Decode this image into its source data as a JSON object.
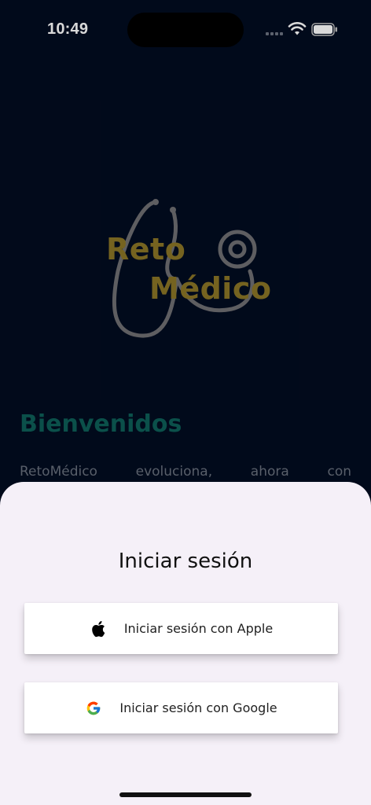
{
  "status_bar": {
    "time": "10:49"
  },
  "logo": {
    "line1": "Reto",
    "line2": "Médico"
  },
  "welcome": {
    "title": "Bienvenidos",
    "intro_words": [
      "RetoMédico",
      "evoluciona,",
      "ahora",
      "con"
    ]
  },
  "sheet": {
    "title": "Iniciar sesión",
    "apple_label": "Iniciar sesión con Apple",
    "google_label": "Iniciar sesión con Google"
  },
  "icons": {
    "apple": "apple-icon",
    "google": "google-icon",
    "wifi": "wifi-icon",
    "battery": "battery-icon",
    "signal": "signal-icon"
  },
  "colors": {
    "background": "#020c20",
    "logo_gold": "#8a7526",
    "welcome_teal": "#0d5f58",
    "sheet_bg": "#f5f0f8"
  }
}
